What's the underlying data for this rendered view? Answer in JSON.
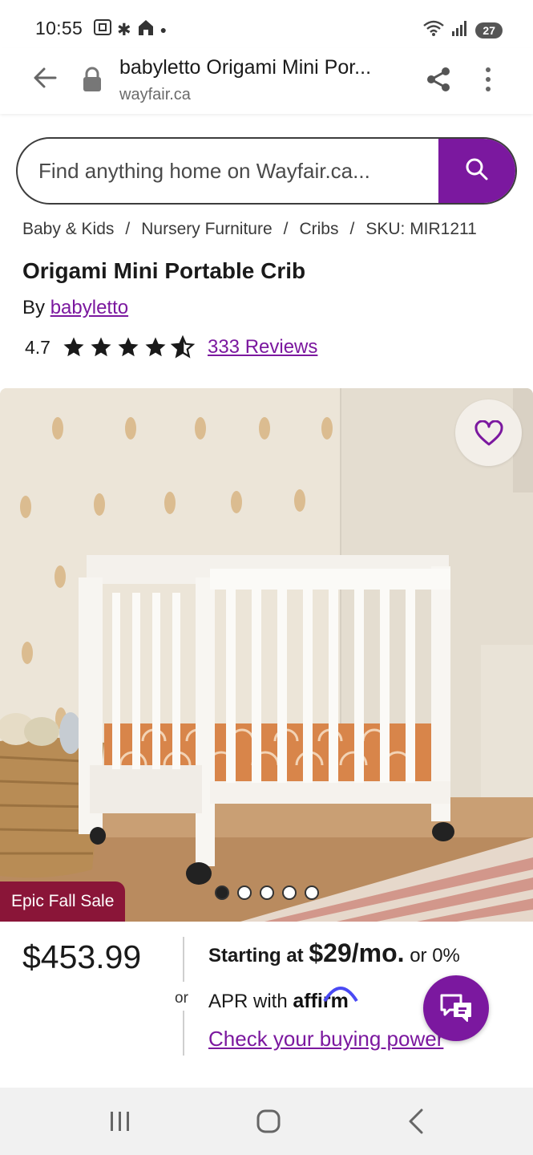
{
  "status_bar": {
    "time": "10:55",
    "battery": "27",
    "icons": [
      "screenshot-icon",
      "pinwheel-icon",
      "home-icon",
      "dot-icon",
      "wifi-icon",
      "signal-icon"
    ]
  },
  "browser": {
    "page_title": "babyletto Origami Mini Por...",
    "domain": "wayfair.ca"
  },
  "search": {
    "placeholder": "Find anything home on Wayfair.ca..."
  },
  "breadcrumb": [
    "Baby & Kids",
    "Nursery Furniture",
    "Cribs",
    "SKU: MIR1211"
  ],
  "product": {
    "title": "Origami Mini Portable Crib",
    "by_label": "By",
    "brand": "babyletto",
    "rating": "4.7",
    "rating_value": 4.7,
    "rating_max": 5,
    "reviews": "333 Reviews",
    "sale_badge": "Epic Fall Sale",
    "image_count": 5,
    "active_image": 0
  },
  "pricing": {
    "price": "$453.99",
    "or": "or",
    "starting_at": "Starting at",
    "monthly": "$29/mo.",
    "or_zero": "or 0%",
    "apr_with": "APR with",
    "affirm": "affirm",
    "check_link": "Check your buying power"
  },
  "colors": {
    "brand_purple": "#7b189f",
    "sale_red": "#8a1538"
  }
}
